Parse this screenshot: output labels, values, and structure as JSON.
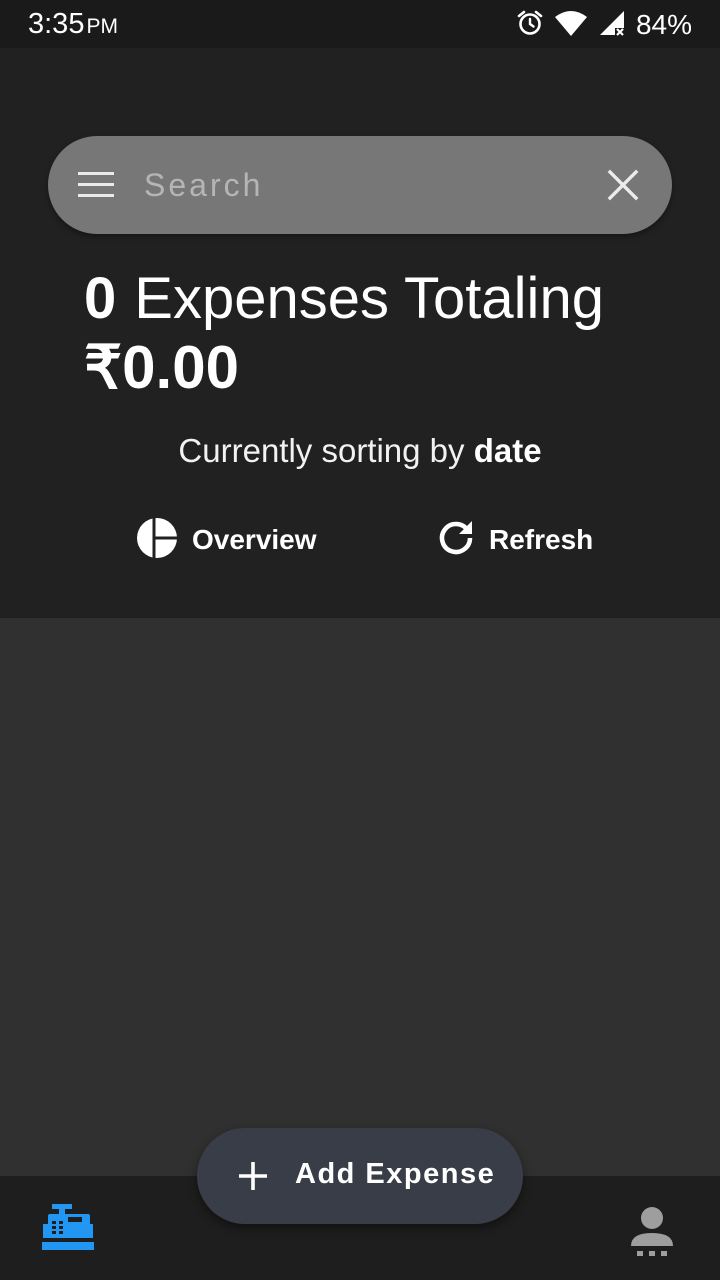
{
  "status_bar": {
    "time": "3:35",
    "ampm": "PM",
    "battery": "84%",
    "icons": [
      "alarm-icon",
      "wifi-icon",
      "signal-icon"
    ]
  },
  "search": {
    "placeholder": "Search",
    "value": ""
  },
  "summary": {
    "count": "0",
    "label": "Expenses Totaling",
    "total": "₹0.00"
  },
  "sorting": {
    "prefix": "Currently sorting by",
    "field": "date"
  },
  "actions": {
    "overview_label": "Overview",
    "refresh_label": "Refresh"
  },
  "fab": {
    "label": "Add Expense"
  },
  "bottom_nav": {
    "active_tab": "expenses",
    "accent_color": "#2196f3",
    "inactive_color": "#9e9e9e"
  },
  "colors": {
    "header_bg": "#212121",
    "body_bg": "#303030",
    "search_bg": "#777777",
    "fab_bg": "#383d47"
  }
}
